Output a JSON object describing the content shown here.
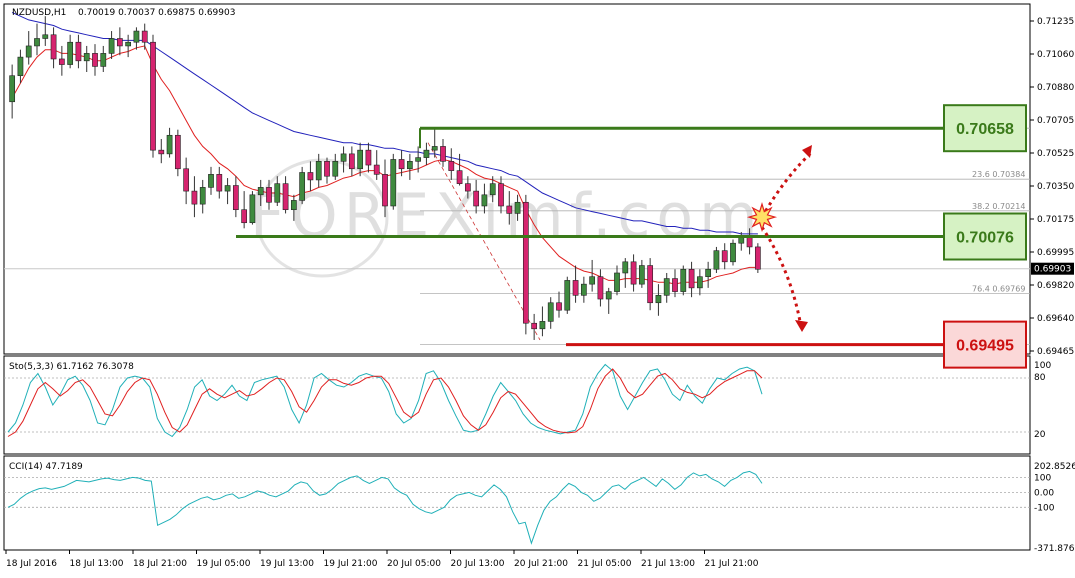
{
  "colors": {
    "bull": "#3f8a3f",
    "bear": "#d6246f",
    "ma_fast": "#e02020",
    "ma_slow": "#2222bb",
    "resistance": "#3a7a1a",
    "support": "#cc1111",
    "sto_main": "#20b0b8",
    "sto_signal": "#e02020",
    "cci": "#20b0b8",
    "box_green_fill": "#d6f2c4",
    "box_red_fill": "#fbd8d8",
    "projection": "#cc1111",
    "fib": "#b0b0b0"
  },
  "header": {
    "instrument_label": "NZDUSD,H1",
    "ohlc_label": "0.70019 0.70037 0.69875 0.69903"
  },
  "watermark": "FOREXimf.com",
  "chart_data": [
    {
      "type": "candlestick",
      "title": "NZDUSD,H1",
      "ylim": [
        0.6945,
        0.7132
      ],
      "y_ticks": [
        "0.71235",
        "0.71060",
        "0.70880",
        "0.70705",
        "0.70525",
        "0.70350",
        "0.70175",
        "0.69995",
        "0.69820",
        "0.69640",
        "0.69465"
      ],
      "current_price": "0.69903",
      "x_labels": [
        "18 Jul 2016",
        "18 Jul 13:00",
        "18 Jul 21:00",
        "19 Jul 05:00",
        "19 Jul 13:00",
        "19 Jul 21:00",
        "20 Jul 05:00",
        "20 Jul 13:00",
        "20 Jul 21:00",
        "21 Jul 05:00",
        "21 Jul 13:00",
        "21 Jul 21:00"
      ],
      "candles": [
        [
          0.708,
          0.71,
          0.7071,
          0.7094
        ],
        [
          0.7094,
          0.7108,
          0.709,
          0.7104
        ],
        [
          0.7104,
          0.7118,
          0.71,
          0.711
        ],
        [
          0.711,
          0.7122,
          0.7105,
          0.7114
        ],
        [
          0.7114,
          0.7126,
          0.711,
          0.7116
        ],
        [
          0.7116,
          0.712,
          0.7098,
          0.7103
        ],
        [
          0.7103,
          0.711,
          0.7094,
          0.71
        ],
        [
          0.71,
          0.7116,
          0.7098,
          0.7112
        ],
        [
          0.7112,
          0.7116,
          0.7098,
          0.7102
        ],
        [
          0.7102,
          0.711,
          0.7096,
          0.7106
        ],
        [
          0.7106,
          0.7111,
          0.7094,
          0.7099
        ],
        [
          0.7099,
          0.711,
          0.7096,
          0.7106
        ],
        [
          0.7106,
          0.7118,
          0.7103,
          0.7114
        ],
        [
          0.7114,
          0.712,
          0.7105,
          0.711
        ],
        [
          0.711,
          0.7116,
          0.7104,
          0.7112
        ],
        [
          0.7112,
          0.712,
          0.7108,
          0.7118
        ],
        [
          0.7118,
          0.7122,
          0.7108,
          0.7112
        ],
        [
          0.7112,
          0.7116,
          0.705,
          0.7054
        ],
        [
          0.7054,
          0.706,
          0.7047,
          0.7052
        ],
        [
          0.7052,
          0.7066,
          0.705,
          0.7062
        ],
        [
          0.7062,
          0.7065,
          0.704,
          0.7044
        ],
        [
          0.7044,
          0.705,
          0.7025,
          0.7032
        ],
        [
          0.7032,
          0.704,
          0.7018,
          0.7025
        ],
        [
          0.7025,
          0.7038,
          0.702,
          0.7034
        ],
        [
          0.7034,
          0.7045,
          0.703,
          0.7041
        ],
        [
          0.7041,
          0.7045,
          0.7028,
          0.7032
        ],
        [
          0.7032,
          0.7039,
          0.7025,
          0.7035
        ],
        [
          0.7035,
          0.704,
          0.7018,
          0.7022
        ],
        [
          0.7022,
          0.7032,
          0.7012,
          0.7015
        ],
        [
          0.7015,
          0.7032,
          0.7014,
          0.703
        ],
        [
          0.703,
          0.7038,
          0.7024,
          0.7034
        ],
        [
          0.7034,
          0.7038,
          0.7022,
          0.7026
        ],
        [
          0.7026,
          0.704,
          0.7024,
          0.7036
        ],
        [
          0.7036,
          0.704,
          0.702,
          0.7022
        ],
        [
          0.7022,
          0.703,
          0.7016,
          0.7027
        ],
        [
          0.7027,
          0.7045,
          0.7025,
          0.7042
        ],
        [
          0.7042,
          0.7048,
          0.7032,
          0.7038
        ],
        [
          0.7038,
          0.7052,
          0.7034,
          0.7048
        ],
        [
          0.7048,
          0.705,
          0.7036,
          0.704
        ],
        [
          0.704,
          0.7052,
          0.7038,
          0.7048
        ],
        [
          0.7048,
          0.7056,
          0.7042,
          0.7052
        ],
        [
          0.7052,
          0.7056,
          0.704,
          0.7044
        ],
        [
          0.7044,
          0.7058,
          0.704,
          0.7054
        ],
        [
          0.7054,
          0.7058,
          0.7042,
          0.7046
        ],
        [
          0.7046,
          0.7054,
          0.7038,
          0.7041
        ],
        [
          0.7041,
          0.7049,
          0.7018,
          0.7024
        ],
        [
          0.7024,
          0.7052,
          0.7022,
          0.7049
        ],
        [
          0.7049,
          0.7054,
          0.704,
          0.7044
        ],
        [
          0.7044,
          0.7052,
          0.7038,
          0.7048
        ],
        [
          0.7048,
          0.7056,
          0.7042,
          0.705
        ],
        [
          0.705,
          0.7058,
          0.7046,
          0.7054
        ],
        [
          0.7054,
          0.7066,
          0.705,
          0.7056
        ],
        [
          0.7056,
          0.706,
          0.7045,
          0.7048
        ],
        [
          0.7048,
          0.7055,
          0.7038,
          0.7043
        ],
        [
          0.7043,
          0.7052,
          0.7035,
          0.7036
        ],
        [
          0.7036,
          0.704,
          0.7028,
          0.7032
        ],
        [
          0.7032,
          0.7038,
          0.702,
          0.7024
        ],
        [
          0.7024,
          0.7036,
          0.702,
          0.703
        ],
        [
          0.703,
          0.704,
          0.7026,
          0.7036
        ],
        [
          0.7036,
          0.704,
          0.702,
          0.7024
        ],
        [
          0.7024,
          0.7032,
          0.7014,
          0.702
        ],
        [
          0.702,
          0.703,
          0.7016,
          0.7026
        ],
        [
          0.7026,
          0.703,
          0.6955,
          0.6961
        ],
        [
          0.6961,
          0.6966,
          0.6952,
          0.6958
        ],
        [
          0.6958,
          0.697,
          0.6954,
          0.6962
        ],
        [
          0.6962,
          0.6975,
          0.6958,
          0.6972
        ],
        [
          0.6972,
          0.6978,
          0.6964,
          0.6968
        ],
        [
          0.6968,
          0.6986,
          0.6966,
          0.6984
        ],
        [
          0.6984,
          0.6992,
          0.6972,
          0.6976
        ],
        [
          0.6976,
          0.6986,
          0.6972,
          0.6982
        ],
        [
          0.6982,
          0.6995,
          0.6978,
          0.6986
        ],
        [
          0.6986,
          0.699,
          0.697,
          0.6974
        ],
        [
          0.6974,
          0.698,
          0.6966,
          0.6978
        ],
        [
          0.6978,
          0.6992,
          0.6976,
          0.6988
        ],
        [
          0.6988,
          0.6996,
          0.698,
          0.6994
        ],
        [
          0.6994,
          0.6998,
          0.6978,
          0.6982
        ],
        [
          0.6982,
          0.6995,
          0.698,
          0.6992
        ],
        [
          0.6992,
          0.6996,
          0.6968,
          0.6972
        ],
        [
          0.6972,
          0.6982,
          0.6965,
          0.6976
        ],
        [
          0.6976,
          0.6988,
          0.6972,
          0.6985
        ],
        [
          0.6985,
          0.699,
          0.6975,
          0.6978
        ],
        [
          0.6978,
          0.6992,
          0.6976,
          0.699
        ],
        [
          0.699,
          0.6994,
          0.6975,
          0.698
        ],
        [
          0.698,
          0.699,
          0.6976,
          0.6986
        ],
        [
          0.6986,
          0.6994,
          0.698,
          0.699
        ],
        [
          0.699,
          0.7002,
          0.6988,
          0.7
        ],
        [
          0.7,
          0.7004,
          0.699,
          0.6994
        ],
        [
          0.6994,
          0.7006,
          0.6992,
          0.7004
        ],
        [
          0.7004,
          0.701,
          0.7,
          0.7008
        ],
        [
          0.7008,
          0.7012,
          0.6998,
          0.7002
        ],
        [
          0.7002,
          0.7004,
          0.6988,
          0.699
        ]
      ],
      "ma_fast": [
        0.7082,
        0.709,
        0.7098,
        0.7104,
        0.7108,
        0.7108,
        0.7106,
        0.7106,
        0.7105,
        0.7104,
        0.7102,
        0.7102,
        0.7104,
        0.7106,
        0.7107,
        0.7109,
        0.711,
        0.71,
        0.7092,
        0.7086,
        0.7078,
        0.707,
        0.7062,
        0.7056,
        0.7052,
        0.7047,
        0.7044,
        0.704,
        0.7035,
        0.7033,
        0.7032,
        0.7031,
        0.7031,
        0.703,
        0.7029,
        0.7031,
        0.7032,
        0.7034,
        0.7035,
        0.7037,
        0.7039,
        0.704,
        0.7042,
        0.7043,
        0.7043,
        0.704,
        0.7041,
        0.7042,
        0.7043,
        0.7044,
        0.7046,
        0.7048,
        0.7049,
        0.7048,
        0.7046,
        0.7044,
        0.7041,
        0.7039,
        0.7038,
        0.7036,
        0.7034,
        0.7032,
        0.7022,
        0.7014,
        0.7007,
        0.7002,
        0.6997,
        0.6994,
        0.6991,
        0.6989,
        0.6988,
        0.6986,
        0.6984,
        0.6984,
        0.6985,
        0.6985,
        0.6985,
        0.6984,
        0.6983,
        0.6983,
        0.6982,
        0.6983,
        0.6983,
        0.6983,
        0.6984,
        0.6986,
        0.6987,
        0.6988,
        0.699,
        0.6991,
        0.6991
      ],
      "ma_slow": [
        0.7128,
        0.7126,
        0.7124,
        0.7123,
        0.7122,
        0.7121,
        0.7119,
        0.7118,
        0.7117,
        0.7116,
        0.7115,
        0.7114,
        0.7114,
        0.7113,
        0.7113,
        0.7113,
        0.7113,
        0.711,
        0.7107,
        0.7104,
        0.7101,
        0.7098,
        0.7095,
        0.7092,
        0.7089,
        0.7086,
        0.7083,
        0.708,
        0.7077,
        0.7074,
        0.7072,
        0.707,
        0.7068,
        0.7066,
        0.7064,
        0.7063,
        0.7062,
        0.7061,
        0.706,
        0.7059,
        0.7058,
        0.7058,
        0.7057,
        0.7057,
        0.7056,
        0.7055,
        0.7055,
        0.7054,
        0.7053,
        0.7053,
        0.7052,
        0.7052,
        0.7051,
        0.705,
        0.7049,
        0.7048,
        0.7046,
        0.7045,
        0.7044,
        0.7043,
        0.7041,
        0.704,
        0.7037,
        0.7034,
        0.7031,
        0.7029,
        0.7027,
        0.7025,
        0.7023,
        0.7022,
        0.7021,
        0.702,
        0.7019,
        0.7018,
        0.7017,
        0.7016,
        0.7016,
        0.7015,
        0.7014,
        0.7013,
        0.7013,
        0.7012,
        0.7012,
        0.7011,
        0.7011,
        0.701,
        0.701,
        0.701,
        0.7009,
        0.7009,
        0.7009
      ],
      "levels": [
        {
          "label": "0.70658",
          "value": 0.70658,
          "kind": "resistance"
        },
        {
          "label": "0.70076",
          "value": 0.70076,
          "kind": "pivot"
        },
        {
          "label": "0.69495",
          "value": 0.69495,
          "kind": "support"
        }
      ],
      "fibonacci": [
        {
          "label": "23.6",
          "price": "0.70384",
          "value": 0.70384
        },
        {
          "label": "38.2",
          "price": "0.70214",
          "value": 0.70214
        },
        {
          "label": "76.4",
          "price": "0.69769",
          "value": 0.69769
        }
      ]
    },
    {
      "type": "line",
      "title": "Sto(5,3,3) 61.7162 76.3078",
      "ylim": [
        0,
        100
      ],
      "y_ticks": [
        "100",
        "80",
        "20"
      ],
      "levels": [
        80,
        20
      ],
      "main": [
        20,
        30,
        50,
        75,
        85,
        70,
        50,
        62,
        78,
        82,
        72,
        55,
        30,
        28,
        45,
        70,
        80,
        82,
        80,
        70,
        35,
        20,
        15,
        25,
        45,
        70,
        78,
        60,
        55,
        62,
        72,
        60,
        55,
        75,
        78,
        80,
        82,
        70,
        45,
        30,
        50,
        80,
        85,
        78,
        72,
        70,
        75,
        82,
        85,
        82,
        80,
        65,
        40,
        30,
        35,
        55,
        85,
        88,
        75,
        55,
        38,
        22,
        20,
        22,
        40,
        60,
        75,
        65,
        55,
        40,
        30,
        25,
        22,
        20,
        18,
        20,
        22,
        40,
        70,
        85,
        95,
        88,
        60,
        45,
        60,
        75,
        88,
        90,
        78,
        62,
        55,
        72,
        60,
        52,
        68,
        80,
        78,
        85,
        90,
        92,
        88,
        62
      ],
      "signal": [
        15,
        20,
        32,
        50,
        68,
        75,
        68,
        60,
        66,
        75,
        78,
        70,
        55,
        40,
        38,
        50,
        65,
        75,
        80,
        78,
        62,
        42,
        25,
        20,
        28,
        45,
        62,
        68,
        62,
        58,
        62,
        66,
        60,
        62,
        68,
        75,
        80,
        78,
        65,
        48,
        42,
        55,
        70,
        78,
        78,
        74,
        72,
        75,
        80,
        82,
        82,
        74,
        58,
        42,
        36,
        42,
        62,
        78,
        80,
        70,
        55,
        38,
        28,
        22,
        28,
        42,
        58,
        65,
        62,
        52,
        42,
        32,
        26,
        22,
        20,
        19,
        20,
        26,
        45,
        68,
        82,
        90,
        80,
        65,
        58,
        62,
        72,
        82,
        85,
        78,
        68,
        64,
        62,
        58,
        62,
        70,
        76,
        80,
        84,
        88,
        88,
        80
      ]
    },
    {
      "type": "line",
      "title": "CCI(14) 47.7189",
      "ylim": [
        -371.8762,
        202.8526
      ],
      "y_ticks": [
        "202.8526",
        "100",
        "0.00",
        "-100",
        "-371.8762"
      ],
      "levels": [
        100,
        0,
        -100
      ],
      "values": [
        -100,
        -80,
        -40,
        -10,
        10,
        25,
        30,
        20,
        30,
        40,
        60,
        80,
        75,
        70,
        80,
        90,
        95,
        85,
        80,
        90,
        100,
        95,
        80,
        75,
        -220,
        -200,
        -180,
        -150,
        -110,
        -80,
        -60,
        -40,
        -30,
        -50,
        -40,
        -20,
        -10,
        -40,
        -30,
        -10,
        10,
        0,
        -20,
        -30,
        -10,
        10,
        50,
        70,
        60,
        10,
        -20,
        -10,
        20,
        60,
        80,
        100,
        110,
        80,
        60,
        80,
        100,
        90,
        30,
        0,
        -20,
        -80,
        -110,
        -130,
        -140,
        -120,
        -100,
        -50,
        -20,
        -10,
        0,
        -20,
        -30,
        10,
        50,
        20,
        -30,
        -130,
        -210,
        -200,
        -340,
        -220,
        -120,
        -60,
        -30,
        20,
        60,
        40,
        0,
        -20,
        -60,
        -40,
        0,
        40,
        50,
        20,
        60,
        80,
        100,
        70,
        40,
        90,
        60,
        20,
        50,
        100,
        130,
        110,
        120,
        90,
        70,
        40,
        80,
        100,
        130,
        140,
        120,
        60
      ]
    }
  ]
}
